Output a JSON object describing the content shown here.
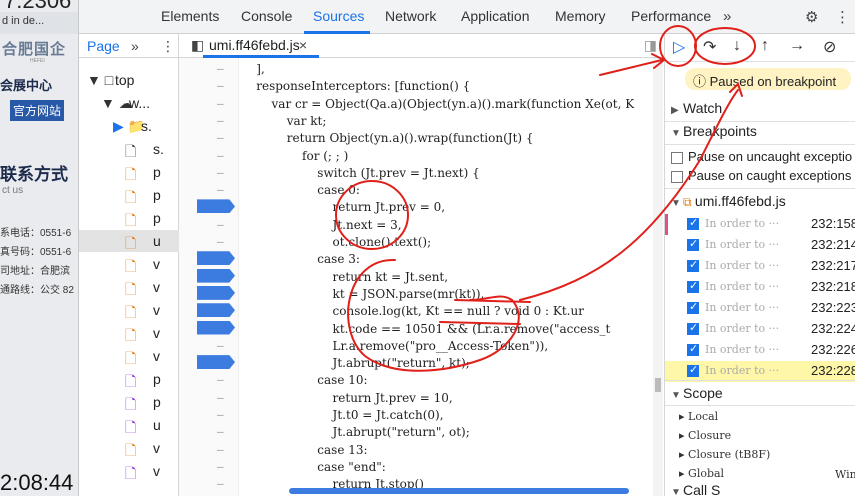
{
  "background_page": {
    "top_number": "7:2306",
    "tab_title": "d in de...",
    "logo": "合肥国企",
    "logo_sub": "HEFEI",
    "center": "会展中心",
    "official_site": "官方网站",
    "contact_title": "联系方式",
    "contact_sub": "ct us",
    "lines": [
      "系电话：0551-6",
      "真号码：0551-6",
      "司地址：合肥滨",
      "通路线：公交 82"
    ],
    "time": "2:08:44"
  },
  "tabs": [
    "Elements",
    "Console",
    "Sources",
    "Network",
    "Application",
    "Memory",
    "Performance"
  ],
  "active_tab": "Sources",
  "more_tabs_icon": "chevron-double-right-icon",
  "navigator": {
    "page_tab": "Page",
    "tree": [
      {
        "icon": "▼ □",
        "label": "top"
      },
      {
        "icon": "▼ ☁",
        "label": "w..."
      },
      {
        "icon": "▶ 📁",
        "label": "s."
      },
      {
        "icon": "🗋",
        "label": "s."
      },
      {
        "icon": "🗋",
        "label": "p"
      },
      {
        "icon": "🗋",
        "label": "p"
      },
      {
        "icon": "🗋",
        "label": "p"
      },
      {
        "icon": "🗋",
        "label": "u"
      },
      {
        "icon": "🗋",
        "label": "v"
      },
      {
        "icon": "🗋",
        "label": "v"
      },
      {
        "icon": "🗋",
        "label": "v"
      },
      {
        "icon": "🗋",
        "label": "v"
      },
      {
        "icon": "🗋",
        "label": "v"
      },
      {
        "icon": "🗋",
        "label": "p"
      },
      {
        "icon": "🗋",
        "label": "p"
      },
      {
        "icon": "🗋",
        "label": "u"
      },
      {
        "icon": "🗋",
        "label": "v"
      },
      {
        "icon": "🗋",
        "label": "v"
      }
    ]
  },
  "editor": {
    "file_tab": "umi.ff46febd.js",
    "close_icon": "×",
    "code_lines": [
      "    ],",
      "    responseInterceptors: [function() {",
      "        var cr = Object(Qa.a)(Object(yn.a)().mark(function Xe(ot, K",
      "            var kt;",
      "            return Object(yn.a)().wrap(function(Jt) {",
      "                for (; ; )",
      "                    switch (Jt.prev = Jt.next) {",
      "                    case 0:",
      "                        return Jt.prev = 0,",
      "                        Jt.next = 3,",
      "                        ot.clone().text();",
      "                    case 3:",
      "                        return kt = Jt.sent,",
      "                        kt = JSON.parse(mr(kt)),",
      "                        console.log(kt, Kt == null ? void 0 : Kt.ur",
      "                        kt.code == 10501 && (Lr.a.remove(\"access_t",
      "                        Lr.a.remove(\"pro__Access-Token\")),",
      "                        Jt.abrupt(\"return\", kt);",
      "                    case 10:",
      "                        return Jt.prev = 10,",
      "                        Jt.t0 = Jt.catch(0),",
      "                        Jt.abrupt(\"return\", ot);",
      "                    case 13:",
      "                    case \"end\":",
      "                        return Jt.stop()"
    ]
  },
  "debugger": {
    "paused_text": "Paused on breakpoint",
    "watch": "Watch",
    "breakpoints": "Breakpoints",
    "pause_uncaught": "Pause on uncaught exceptio",
    "pause_caught": "Pause on caught exceptions",
    "bp_file": "umi.ff46febd.js",
    "bp_rows": [
      {
        "code": "In order to ···",
        "loc": "232:158"
      },
      {
        "code": "In order to ···",
        "loc": "232:214"
      },
      {
        "code": "In order to ···",
        "loc": "232:217"
      },
      {
        "code": "In order to ···",
        "loc": "232:218"
      },
      {
        "code": "In order to ···",
        "loc": "232:223"
      },
      {
        "code": "In order to ···",
        "loc": "232:224"
      },
      {
        "code": "In order to ···",
        "loc": "232:226"
      },
      {
        "code": "In order to ···",
        "loc": "232:228"
      }
    ],
    "scope": "Scope",
    "scope_items": [
      "Local",
      "Closure",
      "Closure (tB8F)",
      "Global"
    ],
    "global_value": "Win",
    "call_stack": "Call S"
  },
  "colors": {
    "accent": "#1a73e8",
    "annotation": "#e0201a",
    "paused_bg": "#fff3c4"
  }
}
